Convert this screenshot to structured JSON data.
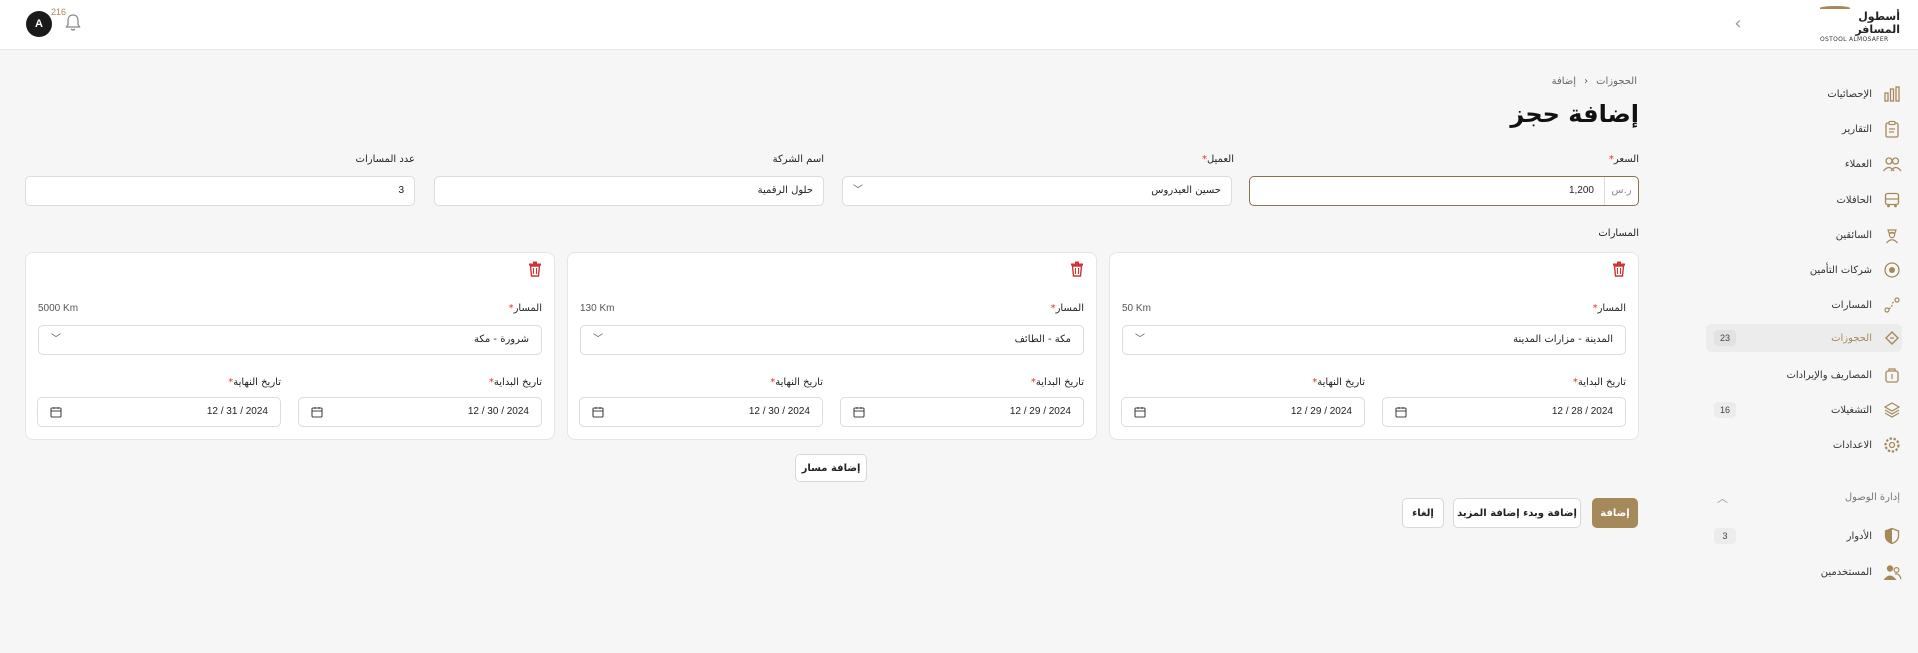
{
  "brand": {
    "name_ar": "أسطول المسافر",
    "name_en": "OSTOOL ALMOSAFER",
    "accent_color": "#a6895a"
  },
  "topbar": {
    "avatar_letter": "A",
    "notification_count": "216",
    "collapse_icon": "chevron-right-icon",
    "bell_icon": "bell-icon"
  },
  "sidebar": {
    "items": [
      {
        "label": "الإحصائيات",
        "icon": "statistics-icon"
      },
      {
        "label": "التقارير",
        "icon": "reports-icon"
      },
      {
        "label": "العملاء",
        "icon": "clients-icon"
      },
      {
        "label": "الحافلات",
        "icon": "bus-icon"
      },
      {
        "label": "السائقين",
        "icon": "driver-icon"
      },
      {
        "label": "شركات التأمين",
        "icon": "insurance-icon"
      },
      {
        "label": "المسارات",
        "icon": "routes-icon"
      },
      {
        "label": "الحجوزات",
        "icon": "ticket-icon",
        "badge": "23",
        "active": true
      },
      {
        "label": "المصاريف والإيرادات",
        "icon": "wallet-icon"
      },
      {
        "label": "التشغيلات",
        "icon": "layers-icon",
        "badge": "16"
      },
      {
        "label": "الاعدادات",
        "icon": "gear-icon"
      }
    ],
    "access_section": {
      "label": "إدارة الوصول",
      "items": [
        {
          "label": "الأدوار",
          "icon": "shield-icon",
          "badge": "3"
        },
        {
          "label": "المستخدمين",
          "icon": "users-icon"
        }
      ]
    }
  },
  "breadcrumb": {
    "parent": "الحجوزات",
    "current": "إضافة"
  },
  "page": {
    "title": "إضافة حجز"
  },
  "form": {
    "price": {
      "label": "السعر",
      "required": true,
      "unit": "ر.س",
      "value": "1,200"
    },
    "client": {
      "label": "العميل",
      "required": true,
      "value": "حسين العيدروس"
    },
    "company": {
      "label": "اسم الشركة",
      "value": "حلول الرقمية"
    },
    "routes_count": {
      "label": "عدد المسارات",
      "value": "3"
    }
  },
  "routes_section": {
    "title": "المسارات",
    "route_label": "المسار",
    "start_label": "تاريخ البداية",
    "end_label": "تاريخ النهاية",
    "routes": [
      {
        "route": "المدينة - مزارات المدينة",
        "distance": "50 Km",
        "start": "12 / 28 / 2024",
        "end": "12 / 29 / 2024"
      },
      {
        "route": "مكة - الطائف",
        "distance": "130 Km",
        "start": "12 / 29 / 2024",
        "end": "12 / 30 / 2024"
      },
      {
        "route": "شرورة - مكة",
        "distance": "5000 Km",
        "start": "12 / 30 / 2024",
        "end": "12 / 31 / 2024"
      }
    ]
  },
  "actions": {
    "add_route": "إضافة مسار",
    "submit": "إضافة",
    "submit_and_more": "إضافة وبدء إضافة المزيد",
    "cancel": "إلغاء"
  },
  "colors": {
    "danger": "#d33333",
    "active_nav_bg": "#ececec"
  }
}
